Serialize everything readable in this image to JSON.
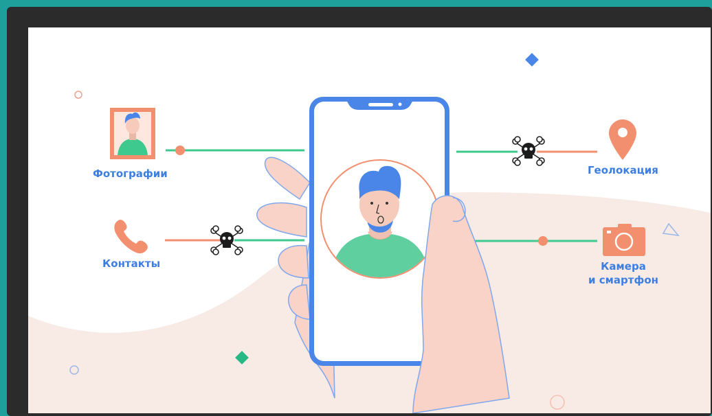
{
  "colors": {
    "teal_border": "#1e9f9c",
    "dark_frame": "#2b2b2b",
    "blue": "#4a86e8",
    "green": "#3ec98f",
    "coral": "#f28f6f",
    "skin": "#f9d3c8",
    "wave": "#f8ebe6"
  },
  "items": {
    "photos": {
      "label": "Фотографии",
      "icon": "photo-portrait-icon",
      "status": "allowed"
    },
    "contacts": {
      "label": "Контакты",
      "icon": "phone-icon",
      "status": "blocked"
    },
    "geolocation": {
      "label": "Геолокация",
      "icon": "location-pin-icon",
      "status": "blocked"
    },
    "camera": {
      "label_line1": "Камера",
      "label_line2": "и смартфон",
      "icon": "camera-icon",
      "status": "allowed"
    }
  }
}
